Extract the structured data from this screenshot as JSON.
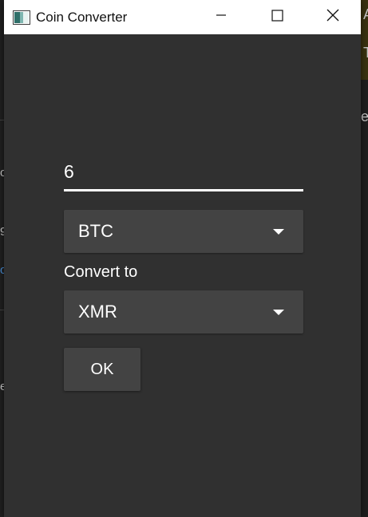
{
  "window": {
    "title": "Coin Converter",
    "icon": "app-window-icon",
    "controls": [
      "minimize-icon",
      "maximize-icon",
      "close-icon"
    ]
  },
  "form": {
    "amount_value": "6",
    "from_currency": "BTC",
    "convert_label": "Convert to",
    "to_currency": "XMR",
    "ok_label": "OK"
  },
  "background_fragments": [
    "A",
    "T",
    "e",
    "o",
    "9",
    "o",
    "e"
  ],
  "colors": {
    "window_bg": "#303030",
    "titlebar_bg": "#ffffff",
    "control_bg": "#434343",
    "text": "#ffffff",
    "underline": "#ffffff"
  }
}
